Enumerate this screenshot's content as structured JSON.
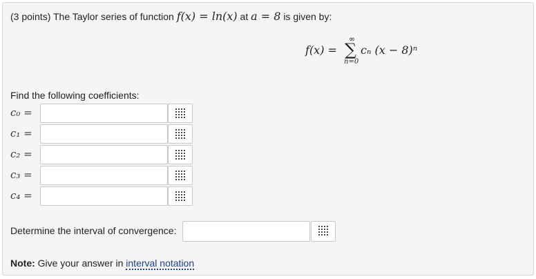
{
  "question": {
    "prefix": "(3 points) The Taylor series of function",
    "func": "f(x) = ln(x)",
    "at_text": "at",
    "point": "a = 8",
    "suffix": "is given by:"
  },
  "formula": {
    "lhs": "f(x) =",
    "sum_top": "∞",
    "sum_symbol": "∑",
    "sum_bottom": "n=0",
    "rhs": "cₙ (x − 8)ⁿ"
  },
  "find_label": "Find the following coefficients:",
  "coefficients": [
    {
      "label": "c₀ =",
      "value": ""
    },
    {
      "label": "c₁ =",
      "value": ""
    },
    {
      "label": "c₂ =",
      "value": ""
    },
    {
      "label": "c₃ =",
      "value": ""
    },
    {
      "label": "c₄ =",
      "value": ""
    }
  ],
  "interval": {
    "label": "Determine the interval of convergence:",
    "value": ""
  },
  "note": {
    "bold": "Note:",
    "text": "Give your answer in",
    "link": "interval notation"
  },
  "icons": {
    "matrix_button": "grid-icon"
  }
}
